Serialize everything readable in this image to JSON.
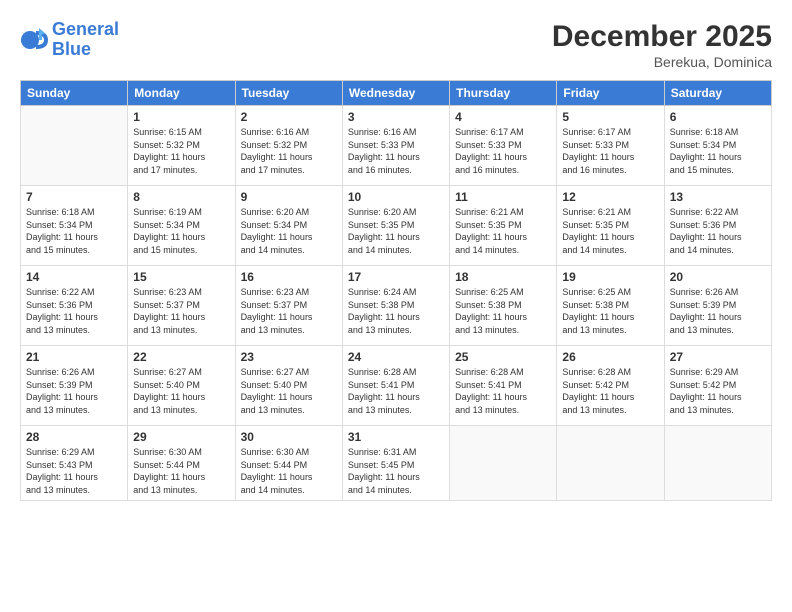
{
  "logo": {
    "line1": "General",
    "line2": "Blue"
  },
  "title": "December 2025",
  "location": "Berekua, Dominica",
  "weekdays": [
    "Sunday",
    "Monday",
    "Tuesday",
    "Wednesday",
    "Thursday",
    "Friday",
    "Saturday"
  ],
  "weeks": [
    [
      {
        "day": "",
        "info": ""
      },
      {
        "day": "1",
        "info": "Sunrise: 6:15 AM\nSunset: 5:32 PM\nDaylight: 11 hours\nand 17 minutes."
      },
      {
        "day": "2",
        "info": "Sunrise: 6:16 AM\nSunset: 5:32 PM\nDaylight: 11 hours\nand 17 minutes."
      },
      {
        "day": "3",
        "info": "Sunrise: 6:16 AM\nSunset: 5:33 PM\nDaylight: 11 hours\nand 16 minutes."
      },
      {
        "day": "4",
        "info": "Sunrise: 6:17 AM\nSunset: 5:33 PM\nDaylight: 11 hours\nand 16 minutes."
      },
      {
        "day": "5",
        "info": "Sunrise: 6:17 AM\nSunset: 5:33 PM\nDaylight: 11 hours\nand 16 minutes."
      },
      {
        "day": "6",
        "info": "Sunrise: 6:18 AM\nSunset: 5:34 PM\nDaylight: 11 hours\nand 15 minutes."
      }
    ],
    [
      {
        "day": "7",
        "info": "Sunrise: 6:18 AM\nSunset: 5:34 PM\nDaylight: 11 hours\nand 15 minutes."
      },
      {
        "day": "8",
        "info": "Sunrise: 6:19 AM\nSunset: 5:34 PM\nDaylight: 11 hours\nand 15 minutes."
      },
      {
        "day": "9",
        "info": "Sunrise: 6:20 AM\nSunset: 5:34 PM\nDaylight: 11 hours\nand 14 minutes."
      },
      {
        "day": "10",
        "info": "Sunrise: 6:20 AM\nSunset: 5:35 PM\nDaylight: 11 hours\nand 14 minutes."
      },
      {
        "day": "11",
        "info": "Sunrise: 6:21 AM\nSunset: 5:35 PM\nDaylight: 11 hours\nand 14 minutes."
      },
      {
        "day": "12",
        "info": "Sunrise: 6:21 AM\nSunset: 5:35 PM\nDaylight: 11 hours\nand 14 minutes."
      },
      {
        "day": "13",
        "info": "Sunrise: 6:22 AM\nSunset: 5:36 PM\nDaylight: 11 hours\nand 14 minutes."
      }
    ],
    [
      {
        "day": "14",
        "info": "Sunrise: 6:22 AM\nSunset: 5:36 PM\nDaylight: 11 hours\nand 13 minutes."
      },
      {
        "day": "15",
        "info": "Sunrise: 6:23 AM\nSunset: 5:37 PM\nDaylight: 11 hours\nand 13 minutes."
      },
      {
        "day": "16",
        "info": "Sunrise: 6:23 AM\nSunset: 5:37 PM\nDaylight: 11 hours\nand 13 minutes."
      },
      {
        "day": "17",
        "info": "Sunrise: 6:24 AM\nSunset: 5:38 PM\nDaylight: 11 hours\nand 13 minutes."
      },
      {
        "day": "18",
        "info": "Sunrise: 6:25 AM\nSunset: 5:38 PM\nDaylight: 11 hours\nand 13 minutes."
      },
      {
        "day": "19",
        "info": "Sunrise: 6:25 AM\nSunset: 5:38 PM\nDaylight: 11 hours\nand 13 minutes."
      },
      {
        "day": "20",
        "info": "Sunrise: 6:26 AM\nSunset: 5:39 PM\nDaylight: 11 hours\nand 13 minutes."
      }
    ],
    [
      {
        "day": "21",
        "info": "Sunrise: 6:26 AM\nSunset: 5:39 PM\nDaylight: 11 hours\nand 13 minutes."
      },
      {
        "day": "22",
        "info": "Sunrise: 6:27 AM\nSunset: 5:40 PM\nDaylight: 11 hours\nand 13 minutes."
      },
      {
        "day": "23",
        "info": "Sunrise: 6:27 AM\nSunset: 5:40 PM\nDaylight: 11 hours\nand 13 minutes."
      },
      {
        "day": "24",
        "info": "Sunrise: 6:28 AM\nSunset: 5:41 PM\nDaylight: 11 hours\nand 13 minutes."
      },
      {
        "day": "25",
        "info": "Sunrise: 6:28 AM\nSunset: 5:41 PM\nDaylight: 11 hours\nand 13 minutes."
      },
      {
        "day": "26",
        "info": "Sunrise: 6:28 AM\nSunset: 5:42 PM\nDaylight: 11 hours\nand 13 minutes."
      },
      {
        "day": "27",
        "info": "Sunrise: 6:29 AM\nSunset: 5:42 PM\nDaylight: 11 hours\nand 13 minutes."
      }
    ],
    [
      {
        "day": "28",
        "info": "Sunrise: 6:29 AM\nSunset: 5:43 PM\nDaylight: 11 hours\nand 13 minutes."
      },
      {
        "day": "29",
        "info": "Sunrise: 6:30 AM\nSunset: 5:44 PM\nDaylight: 11 hours\nand 13 minutes."
      },
      {
        "day": "30",
        "info": "Sunrise: 6:30 AM\nSunset: 5:44 PM\nDaylight: 11 hours\nand 14 minutes."
      },
      {
        "day": "31",
        "info": "Sunrise: 6:31 AM\nSunset: 5:45 PM\nDaylight: 11 hours\nand 14 minutes."
      },
      {
        "day": "",
        "info": ""
      },
      {
        "day": "",
        "info": ""
      },
      {
        "day": "",
        "info": ""
      }
    ]
  ]
}
